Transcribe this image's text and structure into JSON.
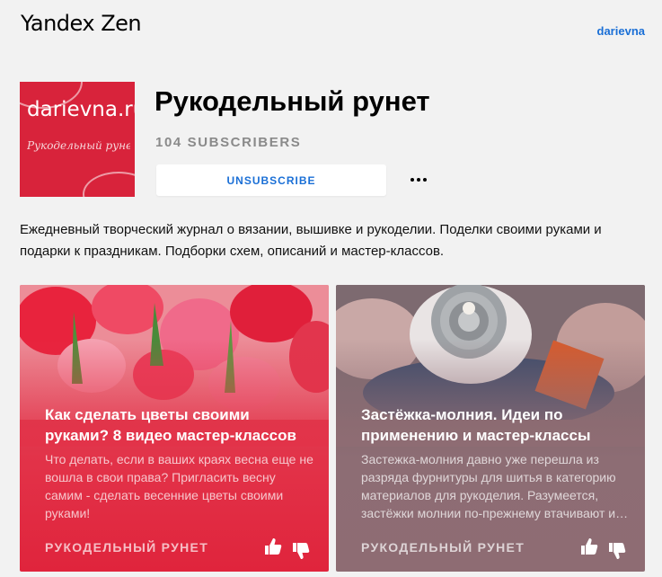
{
  "header": {
    "logo_part1": "Yandex",
    "logo_part2": "Zen",
    "user_name": "darievna"
  },
  "channel": {
    "avatar_site_text": "darievna.ru",
    "title": "Рукодельный рунет",
    "subscribers": "104 SUBSCRIBERS",
    "unsubscribe_label": "UNSUBSCRIBE",
    "description": "Ежедневный творческий журнал о вязании, вышивке и рукоделии. Поделки своими руками и подарки к праздникам. Подборки схем, описаний и мастер-классов."
  },
  "cards": [
    {
      "title": "Как сделать цветы своими руками? 8 видео мастер-классов",
      "snippet": "Что делать, если в ваших краях весна еще не вошла в свои права? Пригласить весну самим - сделать весенние цветы своими руками!",
      "source": "РУКОДЕЛЬНЫЙ РУНЕТ",
      "color": "#e2334a"
    },
    {
      "title": "Застёжка-молния. Идеи по применению и мастер-классы",
      "snippet": "Застежка-молния давно уже перешла из разряда фурнитуры для шитья в категорию материалов для рукоделия. Разумеется, застёжки молнии по-прежнему втачивают и…",
      "source": "РУКОДЕЛЬНЫЙ РУНЕТ",
      "color": "#8e6c73"
    }
  ],
  "colors": {
    "accent": "#1a6fd6",
    "background": "#f2f2f2"
  },
  "icons": [
    "more-icon",
    "like-icon",
    "dislike-icon"
  ]
}
